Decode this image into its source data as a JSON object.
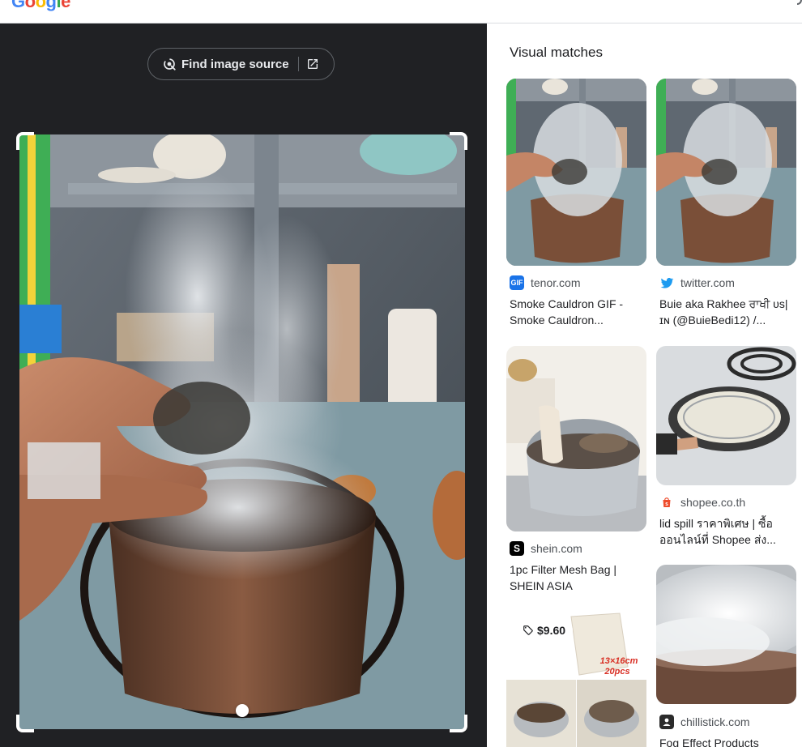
{
  "topbar": {
    "logo_letters": [
      "G",
      "o",
      "o",
      "g",
      "l",
      "e"
    ]
  },
  "colors": {
    "google_blue": "#4285f4",
    "google_red": "#ea4335",
    "google_yellow": "#fbbc05",
    "google_green": "#34a853",
    "dark_panel": "#202124"
  },
  "left_panel": {
    "find_source_label": "Find image source",
    "icons": [
      "lens-search-icon",
      "open-external-icon"
    ]
  },
  "visual_matches": {
    "title": "Visual matches",
    "cards": [
      {
        "favicon": "GIF",
        "domain": "tenor.com",
        "title": "Smoke Cauldron GIF - Smoke Cauldron..."
      },
      {
        "favicon": "twitter-bird-icon",
        "domain": "twitter.com",
        "title": "Buie aka Rakhee ਰਾਖੀ ᴜs|ɪɴ (@BuieBedi12) /..."
      },
      {
        "favicon": "S",
        "domain": "shein.com",
        "title": "1pc Filter Mesh Bag | SHEIN ASIA"
      },
      {
        "favicon": "shopee-bag-icon",
        "domain": "shopee.co.th",
        "title": "lid spill ราคาพิเศษ | ซื้อออนไลน์ที่ Shopee ส่ง..."
      },
      {
        "price": "$9.60",
        "overlay_text": [
          "13×16cm",
          "20pcs"
        ]
      },
      {
        "favicon": "chillistick-icon",
        "domain": "chillistick.com",
        "title": "Fog Effect Products"
      }
    ]
  }
}
